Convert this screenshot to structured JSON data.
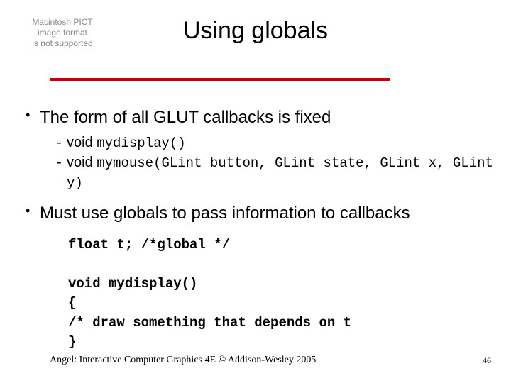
{
  "placeholder": {
    "line1": "Macintosh PICT",
    "line2": "image format",
    "line3": "is not supported"
  },
  "title": "Using globals",
  "bullets": [
    {
      "text": "The form of all GLUT callbacks is fixed",
      "sub": [
        {
          "prefix": "void ",
          "code": "mydisplay()"
        },
        {
          "prefix": "void ",
          "code": "mymouse(GLint button, GLint state, GLint x, GLint y)"
        }
      ]
    },
    {
      "text": "Must use globals to pass information to callbacks",
      "sub": []
    }
  ],
  "code": "float t; /*global */\n\nvoid mydisplay()\n{\n/* draw something that depends on t\n}",
  "footer": "Angel: Interactive Computer Graphics 4E © Addison-Wesley 2005",
  "page": "46"
}
